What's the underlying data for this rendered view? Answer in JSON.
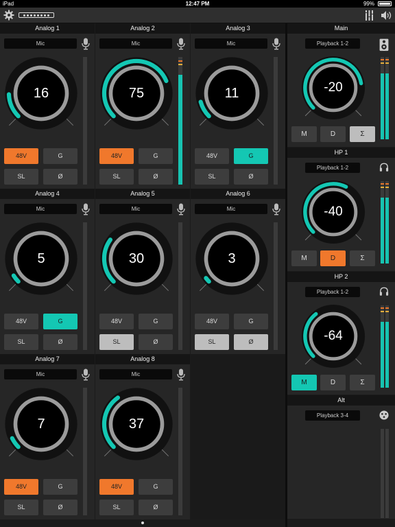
{
  "status_bar": {
    "device": "iPad",
    "time": "12:47 PM",
    "battery": "99%"
  },
  "toolbar": {
    "settings_icon": "gear-icon",
    "device_icon": "interface-device-icon",
    "mixer_icon": "mixer-icon",
    "speaker_icon": "speaker-icon"
  },
  "channels": [
    {
      "name": "Analog 1",
      "source": "Mic",
      "value": "16",
      "level": 0.16,
      "meter": 0,
      "b48v": "48V",
      "g": "G",
      "sl": "SL",
      "phase": "Ø",
      "on48v": true,
      "onG": false,
      "onSL": false,
      "onPh": false
    },
    {
      "name": "Analog 2",
      "source": "Mic",
      "value": "75",
      "level": 0.75,
      "meter": 0.86,
      "b48v": "48V",
      "g": "G",
      "sl": "SL",
      "phase": "Ø",
      "on48v": true,
      "onG": false,
      "onSL": false,
      "onPh": false
    },
    {
      "name": "Analog 3",
      "source": "Mic",
      "value": "11",
      "level": 0.11,
      "meter": 0,
      "b48v": "48V",
      "g": "G",
      "sl": "SL",
      "phase": "Ø",
      "on48v": false,
      "onG": true,
      "onSL": false,
      "onPh": false
    },
    {
      "name": "Analog 4",
      "source": "Mic",
      "value": "5",
      "level": 0.05,
      "meter": 0,
      "b48v": "48V",
      "g": "G",
      "sl": "SL",
      "phase": "Ø",
      "on48v": false,
      "onG": true,
      "onSL": false,
      "onPh": false
    },
    {
      "name": "Analog 5",
      "source": "Mic",
      "value": "30",
      "level": 0.3,
      "meter": 0,
      "b48v": "48V",
      "g": "G",
      "sl": "SL",
      "phase": "Ø",
      "on48v": false,
      "onG": false,
      "onSL": true,
      "onPh": false
    },
    {
      "name": "Analog 6",
      "source": "Mic",
      "value": "3",
      "level": 0.03,
      "meter": 0,
      "b48v": "48V",
      "g": "G",
      "sl": "SL",
      "phase": "Ø",
      "on48v": false,
      "onG": false,
      "onSL": true,
      "onPh": true
    },
    {
      "name": "Analog 7",
      "source": "Mic",
      "value": "7",
      "level": 0.07,
      "meter": 0,
      "b48v": "48V",
      "g": "G",
      "sl": "SL",
      "phase": "Ø",
      "on48v": true,
      "onG": false,
      "onSL": false,
      "onPh": false
    },
    {
      "name": "Analog 8",
      "source": "Mic",
      "value": "37",
      "level": 0.37,
      "meter": 0,
      "b48v": "48V",
      "g": "G",
      "sl": "SL",
      "phase": "Ø",
      "on48v": true,
      "onG": false,
      "onSL": false,
      "onPh": false
    }
  ],
  "outputs": [
    {
      "name": "Main",
      "source": "Playback 1-2",
      "icon": "speaker-monitor-icon",
      "value": "-20",
      "level": 0.8,
      "meter": 0.8,
      "m": "M",
      "d": "D",
      "s": "Σ",
      "onM": false,
      "onD": false,
      "onS": true
    },
    {
      "name": "HP 1",
      "source": "Playback 1-2",
      "icon": "headphones-icon",
      "value": "-40",
      "level": 0.6,
      "meter": 0.8,
      "m": "M",
      "d": "D",
      "s": "Σ",
      "onM": false,
      "onD": true,
      "onS": false
    },
    {
      "name": "HP 2",
      "source": "Playback 1-2",
      "icon": "headphones-icon",
      "value": "-64",
      "level": 0.36,
      "meter": 0.8,
      "m": "M",
      "d": "D",
      "s": "Σ",
      "onM": true,
      "onD": false,
      "onS": false
    },
    {
      "name": "Alt",
      "source": "Playback 3-4",
      "icon": "xlr-connector-icon"
    }
  ],
  "colors": {
    "accent": "#14c7b3",
    "orange": "#f0782c",
    "ring": "#9b9b9b",
    "track": "#111111"
  }
}
